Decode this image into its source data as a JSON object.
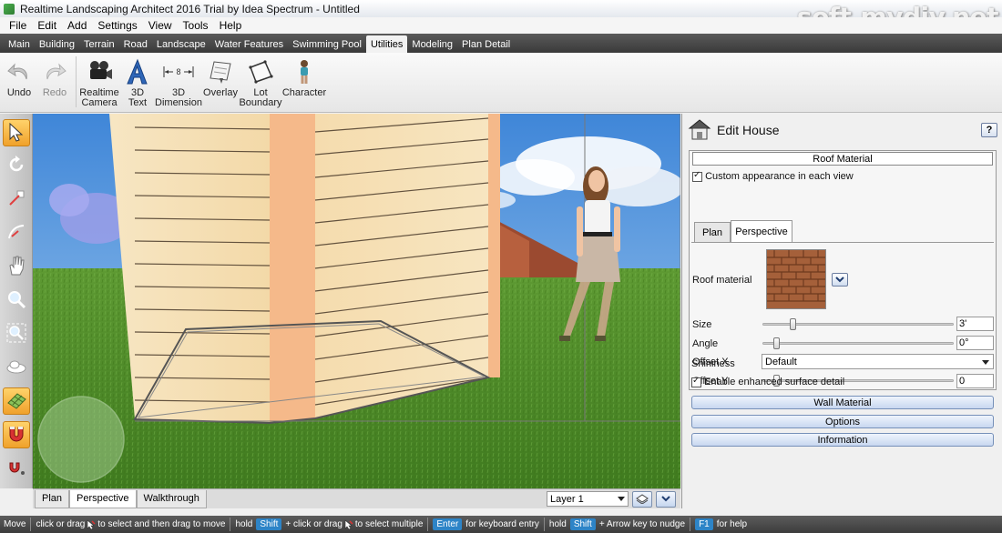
{
  "window": {
    "title": "Realtime Landscaping Architect 2016 Trial by Idea Spectrum - Untitled",
    "watermark": "soft.mydiv.net"
  },
  "menu": [
    "File",
    "Edit",
    "Add",
    "Settings",
    "View",
    "Tools",
    "Help"
  ],
  "tabs": [
    "Main",
    "Building",
    "Terrain",
    "Road",
    "Landscape",
    "Water Features",
    "Swimming Pool",
    "Utilities",
    "Modeling",
    "Plan Detail"
  ],
  "active_tab": "Utilities",
  "toolbar": {
    "undo": "Undo",
    "redo": "Redo",
    "realtime_camera_1": "Realtime",
    "realtime_camera_2": "Camera",
    "text3d_1": "3D",
    "text3d_2": "Text",
    "dim3d_1": "3D",
    "dim3d_2": "Dimension",
    "dim_icon_value": "8",
    "overlay": "Overlay",
    "lot_boundary_1": "Lot",
    "lot_boundary_2": "Boundary",
    "character": "Character"
  },
  "left_tools": [
    "select-arrow-icon",
    "rotate-icon",
    "resize-icon",
    "arc-icon",
    "pan-hand-icon",
    "zoom-icon",
    "zoom-extents-icon",
    "cloud-icon",
    "grid-snap-icon",
    "magnet-icon",
    "magnet-small-icon"
  ],
  "view_tabs": [
    "Plan",
    "Perspective",
    "Walkthrough"
  ],
  "active_view": "Perspective",
  "layer": "Layer 1",
  "panel": {
    "title": "Edit House",
    "help": "?",
    "roof_material_title": "Roof Material",
    "custom_appearance": "Custom appearance in each view",
    "subtabs": [
      "Plan",
      "Perspective"
    ],
    "active_subtab": "Perspective",
    "roof_material_label": "Roof material",
    "size_label": "Size",
    "size_value": "3'",
    "size_slider": 0.15,
    "angle_label": "Angle",
    "angle_value": "0°",
    "angle_slider": 0.06,
    "offset_x_label": "Offset X",
    "offset_x_value": "0",
    "offset_x_slider": 0.06,
    "offset_y_label": "Offset Y",
    "offset_y_value": "0",
    "offset_y_slider": 0.06,
    "shininess_label": "Shininess",
    "shininess_value": "Default",
    "enhanced_detail": "Enable enhanced surface detail",
    "wall_material": "Wall Material",
    "options": "Options",
    "information": "Information"
  },
  "status": {
    "move": "Move",
    "click_or_drag_1": "click or drag",
    "to_select_move": "to select and then drag to move",
    "hold_1": "hold",
    "shift_1": "Shift",
    "plus_click_or_drag": "+ click or drag",
    "to_select_multiple": "to select multiple",
    "enter": "Enter",
    "for_keyboard_entry": "for keyboard entry",
    "hold_2": "hold",
    "shift_2": "Shift",
    "arrow_nudge": "+ Arrow key to nudge",
    "f1": "F1",
    "for_help": "for help"
  },
  "colors": {
    "accent_blue": "#2d84c7",
    "tab_bar": "#4a4a4a",
    "grass": "#5d9c2f",
    "sky": "#5a9be0",
    "siding": "#f4dcb0"
  }
}
